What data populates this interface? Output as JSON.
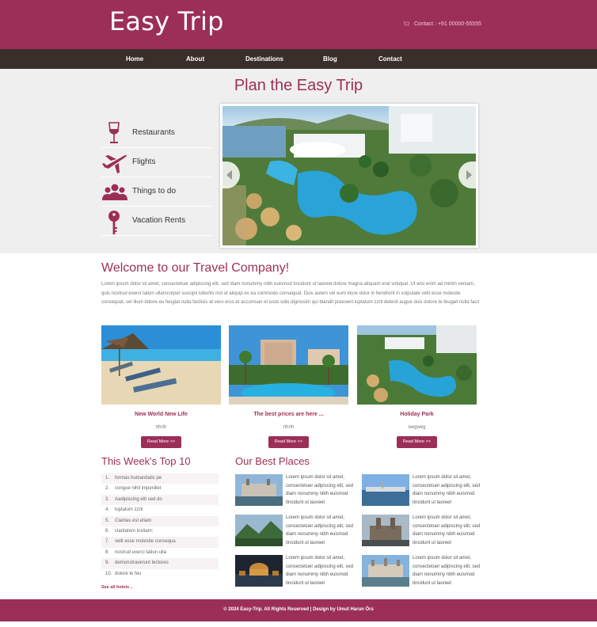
{
  "header": {
    "logo": "Easy Trip",
    "contact": "Contact : +91 00000-55555"
  },
  "nav": {
    "items": [
      "Home",
      "About",
      "Destinations",
      "Blog",
      "Contact"
    ]
  },
  "hero": {
    "title": "Plan the Easy Trip",
    "categories": [
      {
        "label": "Restaurants",
        "icon": "wine-glass-icon"
      },
      {
        "label": "Flights",
        "icon": "airplane-icon"
      },
      {
        "label": "Things to do",
        "icon": "people-icon"
      },
      {
        "label": "Vacation Rents",
        "icon": "key-icon"
      }
    ]
  },
  "welcome": {
    "title": "Welcome to our Travel Company!",
    "text": "Lorem ipsum dolor sit amet, consectetuer adipiscing elit, sed diam nonummy nibh euismod tincidunt ut laoreet dolore magna aliquam erat volutpat. Ut wisi enim ad minim veniam, quis nostrud exerci tation ullamcorper suscipit lobortis nisl ut aliquip ex ea commodo consequat. Duis autem vel eum iriure dolor in hendrerit in vulputate velit esse molestie consequat, vel illum dolore eu feugiat nulla facilisis at vero eros et accumsan et iusto odio dignissim qui blandit praesent luptatum zzril delenit augue duis dolore te feugait nulla facil"
  },
  "cards": [
    {
      "title": "New World New Life",
      "sub": "rthrth",
      "button": "Read More >>"
    },
    {
      "title": "The best prices are here ...",
      "sub": "rthrth",
      "button": "Read More >>"
    },
    {
      "title": "Holiday Park",
      "sub": "wegweg",
      "button": "Read More >>"
    }
  ],
  "top10": {
    "title": "This Week's Top 10",
    "items": [
      "formas humanitatis pe",
      "congue nihil imperdiet",
      "Aadipiscing elit sed do",
      "luptatum zzril",
      "Claritas est etiam",
      "claritatem insitam;",
      "velit esse molestie consequa",
      "nostrud exerci tation ulla",
      "demonstraverunt lectores",
      "dolore te feu"
    ],
    "see_all": "See all hotels .."
  },
  "best_places": {
    "title": "Our Best Places",
    "text": "Lorem ipsum dolor sit amet, consectetuer adipiscing elit, sed diam nonummy nibh euismod tincidunt ut laoreet"
  },
  "footer": {
    "text": "© 2024 Easy-Trip. All Rights Reserved | Design by Umut Harun Örs"
  },
  "colors": {
    "brand": "#9c2f57",
    "nav_bg": "#3a2e2b",
    "hero_bg": "#efefef"
  }
}
